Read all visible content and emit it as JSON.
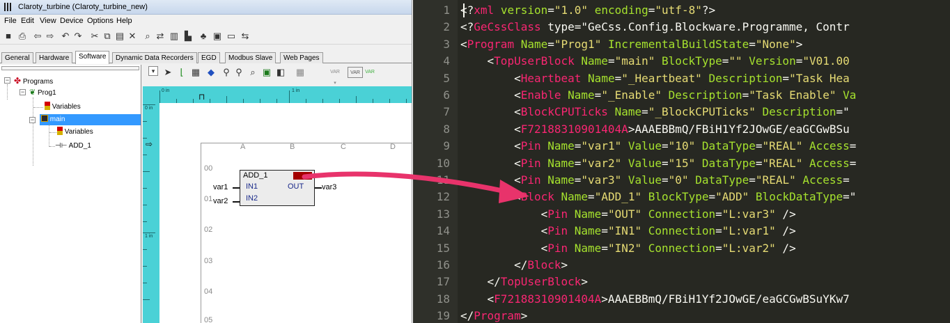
{
  "app": {
    "title": "Claroty_turbine (Claroty_turbine_new)",
    "menu": [
      "File",
      "Edit",
      "View",
      "Device",
      "Options",
      "Help"
    ],
    "tabs": [
      "General",
      "Hardware",
      "Software",
      "Dynamic Data Recorders",
      "EGD",
      "Modbus Slave",
      "Web Pages"
    ],
    "active_tab": "Software",
    "tree": {
      "programs": "Programs",
      "prog1": "Prog1",
      "variables_top": "Variables",
      "main": "main",
      "variables_main": "Variables",
      "add1": "ADD_1"
    },
    "editor": {
      "columns": [
        "A",
        "B",
        "C",
        "D"
      ],
      "rows": [
        "00",
        "01",
        "02",
        "03",
        "04",
        "05"
      ],
      "ruler_top_labels": [
        "0 in",
        "1 in"
      ],
      "ruler_left_labels": [
        "0 in",
        "1 in"
      ],
      "block_name": "ADD_1",
      "pin_in1": "IN1",
      "pin_in2": "IN2",
      "pin_out": "OUT",
      "var_in1": "var1",
      "var_in2": "var2",
      "var_out": "var3"
    }
  },
  "code": {
    "lines": [
      {
        "n": "1",
        "segs": [
          [
            "p",
            "<?"
          ],
          [
            "t",
            "xml"
          ],
          [
            "p",
            " "
          ],
          [
            "a",
            "version"
          ],
          [
            "p",
            "="
          ],
          [
            "v",
            "\"1.0\""
          ],
          [
            "p",
            " "
          ],
          [
            "a",
            "encoding"
          ],
          [
            "p",
            "="
          ],
          [
            "v",
            "\"utf-8\""
          ],
          [
            "p",
            "?>"
          ]
        ]
      },
      {
        "n": "2",
        "segs": [
          [
            "p",
            "<?"
          ],
          [
            "t",
            "GeCssClass"
          ],
          [
            "p",
            " type=\"GeCss.Config.Blockware.Programme, Contr"
          ]
        ]
      },
      {
        "n": "3",
        "segs": [
          [
            "p",
            "<"
          ],
          [
            "t",
            "Program"
          ],
          [
            "p",
            " "
          ],
          [
            "a",
            "Name"
          ],
          [
            "p",
            "="
          ],
          [
            "v",
            "\"Prog1\""
          ],
          [
            "p",
            " "
          ],
          [
            "a",
            "IncrementalBuildState"
          ],
          [
            "p",
            "="
          ],
          [
            "v",
            "\"None\""
          ],
          [
            "p",
            ">"
          ]
        ]
      },
      {
        "n": "4",
        "segs": [
          [
            "p",
            "    <"
          ],
          [
            "t",
            "TopUserBlock"
          ],
          [
            "p",
            " "
          ],
          [
            "a",
            "Name"
          ],
          [
            "p",
            "="
          ],
          [
            "v",
            "\"main\""
          ],
          [
            "p",
            " "
          ],
          [
            "a",
            "BlockType"
          ],
          [
            "p",
            "="
          ],
          [
            "v",
            "\"\""
          ],
          [
            "p",
            " "
          ],
          [
            "a",
            "Version"
          ],
          [
            "p",
            "="
          ],
          [
            "v",
            "\"V01.00"
          ]
        ]
      },
      {
        "n": "5",
        "segs": [
          [
            "p",
            "        <"
          ],
          [
            "t",
            "Heartbeat"
          ],
          [
            "p",
            " "
          ],
          [
            "a",
            "Name"
          ],
          [
            "p",
            "="
          ],
          [
            "v",
            "\"_Heartbeat\""
          ],
          [
            "p",
            " "
          ],
          [
            "a",
            "Description"
          ],
          [
            "p",
            "="
          ],
          [
            "v",
            "\"Task Hea"
          ]
        ]
      },
      {
        "n": "6",
        "segs": [
          [
            "p",
            "        <"
          ],
          [
            "t",
            "Enable"
          ],
          [
            "p",
            " "
          ],
          [
            "a",
            "Name"
          ],
          [
            "p",
            "="
          ],
          [
            "v",
            "\"_Enable\""
          ],
          [
            "p",
            " "
          ],
          [
            "a",
            "Description"
          ],
          [
            "p",
            "="
          ],
          [
            "v",
            "\"Task Enable\""
          ],
          [
            "p",
            " "
          ],
          [
            "a",
            "Va"
          ]
        ]
      },
      {
        "n": "7",
        "segs": [
          [
            "p",
            "        <"
          ],
          [
            "t",
            "BlockCPUTicks"
          ],
          [
            "p",
            " "
          ],
          [
            "a",
            "Name"
          ],
          [
            "p",
            "="
          ],
          [
            "v",
            "\"_BlockCPUTicks\""
          ],
          [
            "p",
            " "
          ],
          [
            "a",
            "Description"
          ],
          [
            "p",
            "=\""
          ]
        ]
      },
      {
        "n": "8",
        "segs": [
          [
            "p",
            "        <"
          ],
          [
            "t",
            "F72188310901404A"
          ],
          [
            "p",
            ">AAAEBBmQ/FBiH1Yf2JOwGE/eaGCGwBSu"
          ]
        ]
      },
      {
        "n": "9",
        "segs": [
          [
            "p",
            "        <"
          ],
          [
            "t",
            "Pin"
          ],
          [
            "p",
            " "
          ],
          [
            "a",
            "Name"
          ],
          [
            "p",
            "="
          ],
          [
            "v",
            "\"var1\""
          ],
          [
            "p",
            " "
          ],
          [
            "a",
            "Value"
          ],
          [
            "p",
            "="
          ],
          [
            "v",
            "\"10\""
          ],
          [
            "p",
            " "
          ],
          [
            "a",
            "DataType"
          ],
          [
            "p",
            "="
          ],
          [
            "v",
            "\"REAL\""
          ],
          [
            "p",
            " "
          ],
          [
            "a",
            "Access"
          ],
          [
            "p",
            "="
          ]
        ]
      },
      {
        "n": "10",
        "segs": [
          [
            "p",
            "        <"
          ],
          [
            "t",
            "Pin"
          ],
          [
            "p",
            " "
          ],
          [
            "a",
            "Name"
          ],
          [
            "p",
            "="
          ],
          [
            "v",
            "\"var2\""
          ],
          [
            "p",
            " "
          ],
          [
            "a",
            "Value"
          ],
          [
            "p",
            "="
          ],
          [
            "v",
            "\"15\""
          ],
          [
            "p",
            " "
          ],
          [
            "a",
            "DataType"
          ],
          [
            "p",
            "="
          ],
          [
            "v",
            "\"REAL\""
          ],
          [
            "p",
            " "
          ],
          [
            "a",
            "Access"
          ],
          [
            "p",
            "="
          ]
        ]
      },
      {
        "n": "11",
        "segs": [
          [
            "p",
            "        <"
          ],
          [
            "t",
            "Pin"
          ],
          [
            "p",
            " "
          ],
          [
            "a",
            "Name"
          ],
          [
            "p",
            "="
          ],
          [
            "v",
            "\"var3\""
          ],
          [
            "p",
            " "
          ],
          [
            "a",
            "Value"
          ],
          [
            "p",
            "="
          ],
          [
            "v",
            "\"0\""
          ],
          [
            "p",
            " "
          ],
          [
            "a",
            "DataType"
          ],
          [
            "p",
            "="
          ],
          [
            "v",
            "\"REAL\""
          ],
          [
            "p",
            " "
          ],
          [
            "a",
            "Access"
          ],
          [
            "p",
            "="
          ]
        ]
      },
      {
        "n": "12",
        "segs": [
          [
            "p",
            "        <"
          ],
          [
            "t",
            "Block"
          ],
          [
            "p",
            " "
          ],
          [
            "a",
            "Name"
          ],
          [
            "p",
            "="
          ],
          [
            "v",
            "\"ADD_1\""
          ],
          [
            "p",
            " "
          ],
          [
            "a",
            "BlockType"
          ],
          [
            "p",
            "="
          ],
          [
            "v",
            "\"ADD\""
          ],
          [
            "p",
            " "
          ],
          [
            "a",
            "BlockDataType"
          ],
          [
            "p",
            "=\""
          ]
        ]
      },
      {
        "n": "13",
        "segs": [
          [
            "p",
            "            <"
          ],
          [
            "t",
            "Pin"
          ],
          [
            "p",
            " "
          ],
          [
            "a",
            "Name"
          ],
          [
            "p",
            "="
          ],
          [
            "v",
            "\"OUT\""
          ],
          [
            "p",
            " "
          ],
          [
            "a",
            "Connection"
          ],
          [
            "p",
            "="
          ],
          [
            "v",
            "\"L:var3\""
          ],
          [
            "p",
            " />"
          ]
        ]
      },
      {
        "n": "14",
        "segs": [
          [
            "p",
            "            <"
          ],
          [
            "t",
            "Pin"
          ],
          [
            "p",
            " "
          ],
          [
            "a",
            "Name"
          ],
          [
            "p",
            "="
          ],
          [
            "v",
            "\"IN1\""
          ],
          [
            "p",
            " "
          ],
          [
            "a",
            "Connection"
          ],
          [
            "p",
            "="
          ],
          [
            "v",
            "\"L:var1\""
          ],
          [
            "p",
            " />"
          ]
        ]
      },
      {
        "n": "15",
        "segs": [
          [
            "p",
            "            <"
          ],
          [
            "t",
            "Pin"
          ],
          [
            "p",
            " "
          ],
          [
            "a",
            "Name"
          ],
          [
            "p",
            "="
          ],
          [
            "v",
            "\"IN2\""
          ],
          [
            "p",
            " "
          ],
          [
            "a",
            "Connection"
          ],
          [
            "p",
            "="
          ],
          [
            "v",
            "\"L:var2\""
          ],
          [
            "p",
            " />"
          ]
        ]
      },
      {
        "n": "16",
        "segs": [
          [
            "p",
            "        </"
          ],
          [
            "t",
            "Block"
          ],
          [
            "p",
            ">"
          ]
        ]
      },
      {
        "n": "17",
        "segs": [
          [
            "p",
            "    </"
          ],
          [
            "t",
            "TopUserBlock"
          ],
          [
            "p",
            ">"
          ]
        ]
      },
      {
        "n": "18",
        "segs": [
          [
            "p",
            "    <"
          ],
          [
            "t",
            "F72188310901404A"
          ],
          [
            "p",
            ">AAAEBBmQ/FBiH1Yf2JOwGE/eaGCGwBSuYKw7"
          ]
        ]
      },
      {
        "n": "19",
        "segs": [
          [
            "p",
            "</"
          ],
          [
            "t",
            "Program"
          ],
          [
            "p",
            ">"
          ]
        ]
      }
    ]
  },
  "colors": {
    "code_bg": "#272822",
    "tag": "#f92672",
    "attr": "#a6e22e",
    "value": "#e6db74",
    "arrow": "#e8336b",
    "ruler": "#4ad1d6",
    "selection": "#3399ff"
  }
}
